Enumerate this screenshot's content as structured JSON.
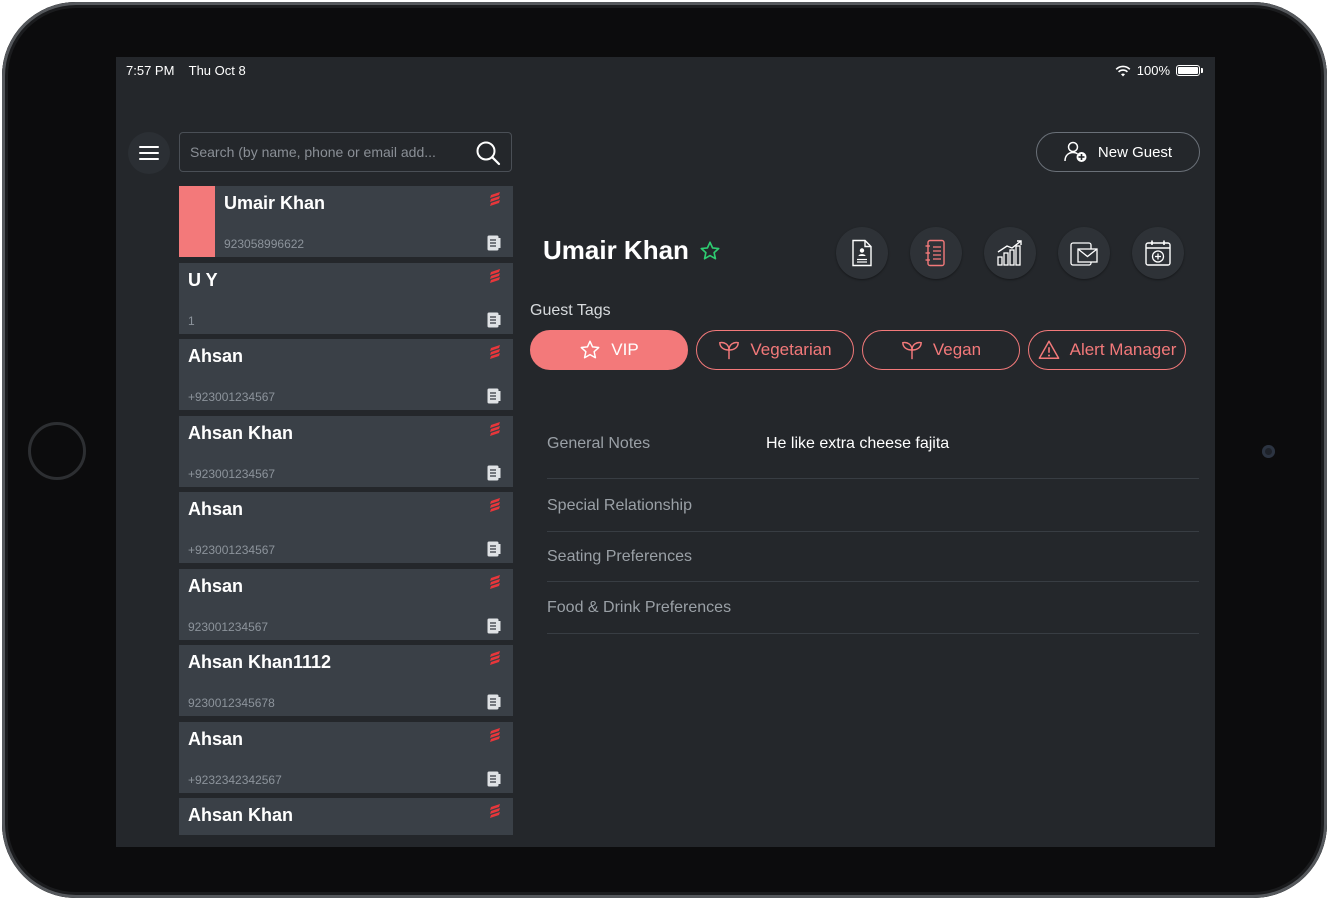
{
  "status_bar": {
    "time": "7:57 PM",
    "date": "Thu Oct 8",
    "battery": "100%"
  },
  "search": {
    "placeholder": "Search (by name, phone or email add..."
  },
  "header": {
    "new_guest_label": "New Guest"
  },
  "guests": [
    {
      "name": "Umair Khan",
      "phone": "923058996622",
      "selected": true
    },
    {
      "name": "U Y",
      "phone": "1"
    },
    {
      "name": "Ahsan",
      "phone": "+923001234567"
    },
    {
      "name": "Ahsan Khan",
      "phone": "+923001234567"
    },
    {
      "name": "Ahsan",
      "phone": "+923001234567"
    },
    {
      "name": "Ahsan",
      "phone": "923001234567"
    },
    {
      "name": "Ahsan Khan1112",
      "phone": "9230012345678"
    },
    {
      "name": "Ahsan",
      "phone": "+9232342342567"
    },
    {
      "name": "Ahsan Khan",
      "phone": ""
    }
  ],
  "detail": {
    "guest_name": "Umair Khan",
    "tags_label": "Guest Tags",
    "tags": [
      {
        "label": "VIP",
        "icon": "star-icon",
        "active": true
      },
      {
        "label": "Vegetarian",
        "icon": "sprout-icon",
        "active": false
      },
      {
        "label": "Vegan",
        "icon": "sprout-icon",
        "active": false
      },
      {
        "label": "Alert Manager",
        "icon": "warning-icon",
        "active": false
      }
    ],
    "notes": [
      {
        "label": "General Notes",
        "value": "He like extra cheese fajita"
      },
      {
        "label": "Special Relationship",
        "value": ""
      },
      {
        "label": "Seating Preferences",
        "value": ""
      },
      {
        "label": "Food & Drink Preferences",
        "value": ""
      }
    ]
  },
  "colors": {
    "accent": "#f3797a",
    "background": "#24272b",
    "card": "#3a4047",
    "favorite": "#2ecc71"
  }
}
